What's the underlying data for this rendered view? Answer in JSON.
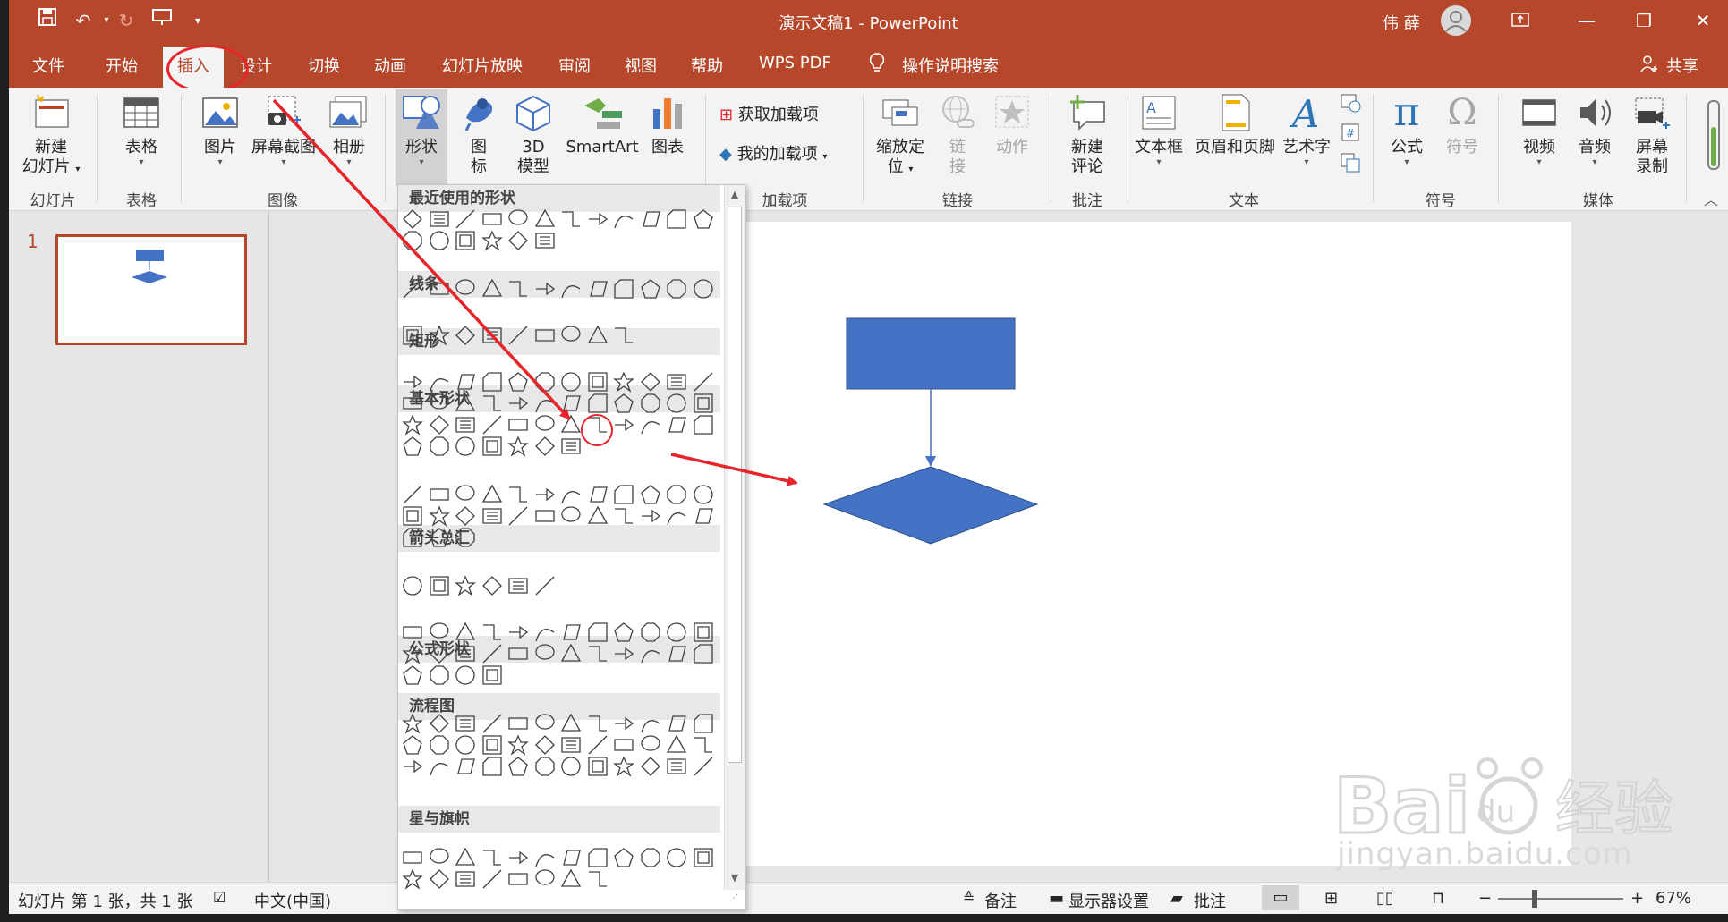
{
  "window": {
    "title": "演示文稿1  -  PowerPoint",
    "user": "伟 薛",
    "share": "共享",
    "search": "操作说明搜索"
  },
  "tabs": [
    "文件",
    "开始",
    "插入",
    "设计",
    "切换",
    "动画",
    "幻灯片放映",
    "审阅",
    "视图",
    "帮助",
    "WPS PDF"
  ],
  "active_tab": "插入",
  "ribbon": {
    "new_slide": [
      "新建",
      "幻灯片"
    ],
    "table": "表格",
    "picture": "图片",
    "screenshot": "屏幕截图",
    "album": "相册",
    "shapes": "形状",
    "icons": [
      "图",
      "标"
    ],
    "model3d": [
      "3D",
      "模型"
    ],
    "smartart": "SmartArt",
    "chart": "图表",
    "get_addins": "获取加载项",
    "my_addins": "我的加载项",
    "zoom": [
      "缩放定",
      "位"
    ],
    "link": [
      "链",
      "接"
    ],
    "action": "动作",
    "new_comment": [
      "新建",
      "评论"
    ],
    "textbox": "文本框",
    "header_footer": "页眉和页脚",
    "wordart": "艺术字",
    "equation": "公式",
    "symbol": "符号",
    "video": "视频",
    "audio": "音频",
    "screen_record": [
      "屏幕",
      "录制"
    ],
    "groups": {
      "slides": "幻灯片",
      "tables": "表格",
      "images": "图像",
      "addins": "加载项",
      "links": "链接",
      "comments": "批注",
      "text": "文本",
      "symbols": "符号",
      "media": "媒体"
    }
  },
  "thumbnail": {
    "number": "1"
  },
  "shape_gallery": {
    "sections": [
      "最近使用的形状",
      "线条",
      "矩形",
      "基本形状",
      "箭头总汇",
      "公式形状",
      "流程图",
      "星与旗帜"
    ]
  },
  "status": {
    "slide_info": "幻灯片 第 1 张，共 1 张",
    "language": "中文(中国)",
    "notes": "备注",
    "display_settings": "显示器设置",
    "comments": "批注",
    "zoom": "67%"
  },
  "watermark": {
    "url": "jingyan.baidu.com"
  },
  "colors": {
    "brand": "#b7472a",
    "shape_fill": "#4472c4",
    "annotation": "#e8242b"
  }
}
